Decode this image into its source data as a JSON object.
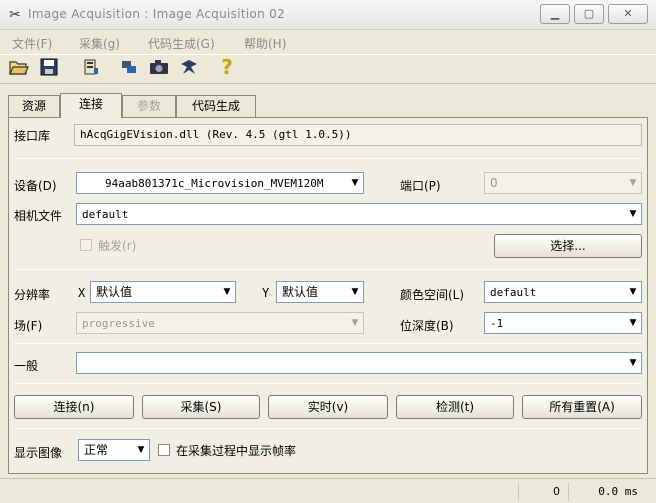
{
  "window": {
    "title": "Image Acquisition : Image Acquisition 02",
    "app_icon": "halcon-app-icon",
    "buttons": {
      "minimize": "▁",
      "maximize": "▢",
      "close": "✕"
    }
  },
  "menu": [
    "文件(F)",
    "采集(g)",
    "代码生成(G)",
    "帮助(H)"
  ],
  "toolbar": {
    "icons": [
      "open-folder-icon",
      "save-icon",
      "device-icon",
      "connect-icon",
      "camera-icon",
      "live-icon",
      "help-icon"
    ],
    "glyphs": [
      "🗁",
      "🖫",
      "📋",
      "⇄",
      "📷",
      "✱",
      "?"
    ]
  },
  "tabs": [
    {
      "label": "资源",
      "state": "normal"
    },
    {
      "label": "连接",
      "state": "active"
    },
    {
      "label": "参数",
      "state": "disabled"
    },
    {
      "label": "代码生成",
      "state": "normal"
    }
  ],
  "interface": {
    "label": "接口库",
    "value": "hAcqGigEVision.dll (Rev. 4.5 (gtl 1.0.5))"
  },
  "device": {
    "label": "设备(D)",
    "value": "94aab801371c_Microvision_MVEM120M"
  },
  "port": {
    "label": "端口(P)",
    "value": "0"
  },
  "camera_file": {
    "label": "相机文件",
    "value": "default"
  },
  "trigger": {
    "label": "触发(r)",
    "checked": false
  },
  "select_button": "选择...",
  "resolution": {
    "label": "分辨率",
    "x_label": "X",
    "x_value": "默认值",
    "y_label": "Y",
    "y_value": "默认值"
  },
  "color_space": {
    "label": "颜色空间(L)",
    "value": "default"
  },
  "field": {
    "label": "场(F)",
    "value": "progressive"
  },
  "bit_depth": {
    "label": "位深度(B)",
    "value": "-1"
  },
  "general": {
    "label": "一般",
    "value": ""
  },
  "actions": [
    "连接(n)",
    "采集(S)",
    "实时(v)",
    "检测(t)",
    "所有重置(A)"
  ],
  "display": {
    "label": "显示图像",
    "value": "正常",
    "framerate_checkbox": "在采集过程中显示帧率",
    "checked": false
  },
  "status": {
    "count": "0",
    "time": "0.0 ms"
  }
}
